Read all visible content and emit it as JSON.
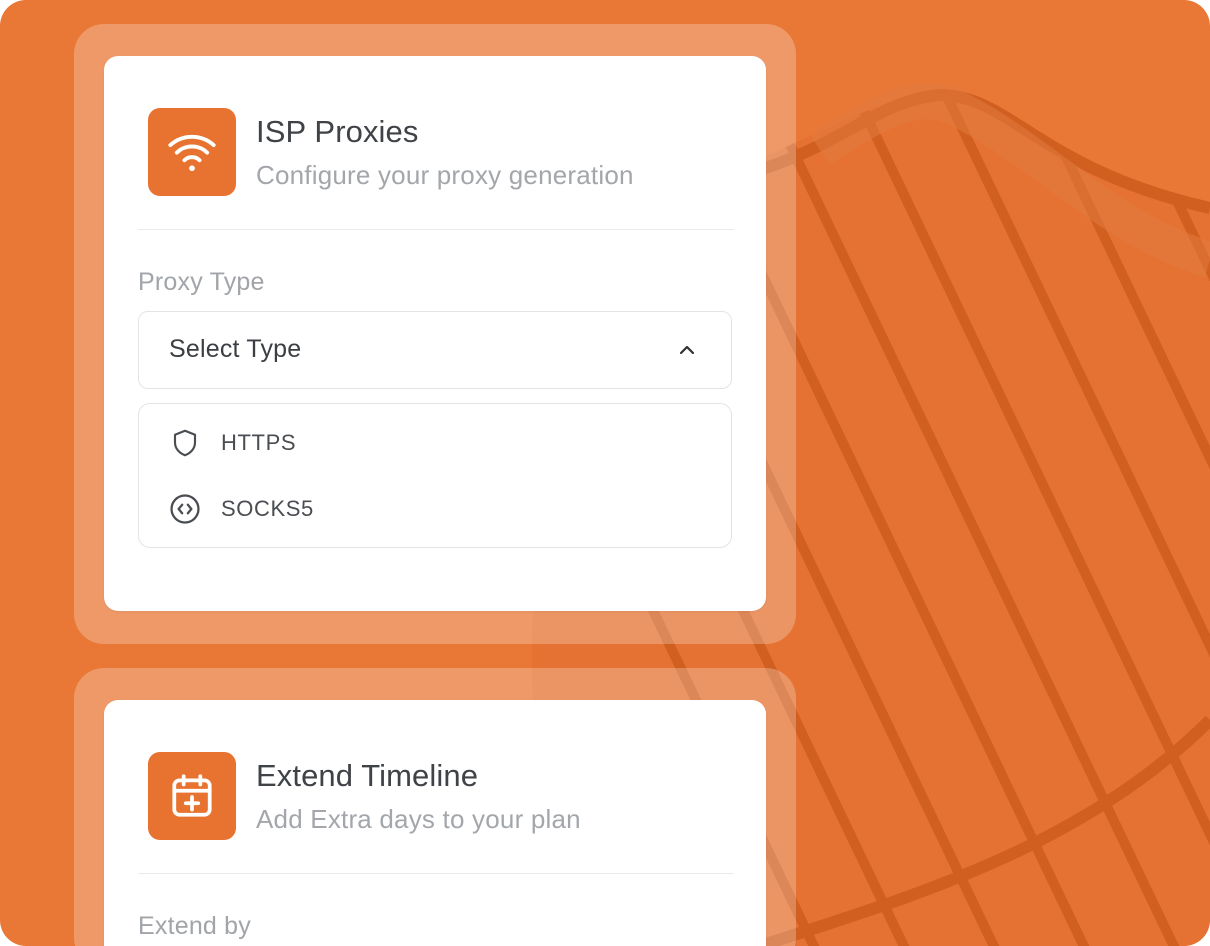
{
  "colors": {
    "background": "#E97735",
    "accent": "#E8722F",
    "card": "#ffffff"
  },
  "proxy_card": {
    "icon": "wifi-icon",
    "title": "ISP Proxies",
    "subtitle": "Configure your proxy generation",
    "field_label": "Proxy Type",
    "select": {
      "value": "Select Type",
      "expanded": true
    },
    "options": [
      {
        "label": "HTTPS",
        "icon": "shield-icon"
      },
      {
        "label": "SOCKS5",
        "icon": "code-circle-icon"
      }
    ]
  },
  "timeline_card": {
    "icon": "calendar-plus-icon",
    "title": "Extend Timeline",
    "subtitle": "Add Extra days to your plan",
    "field_label": "Extend by"
  }
}
